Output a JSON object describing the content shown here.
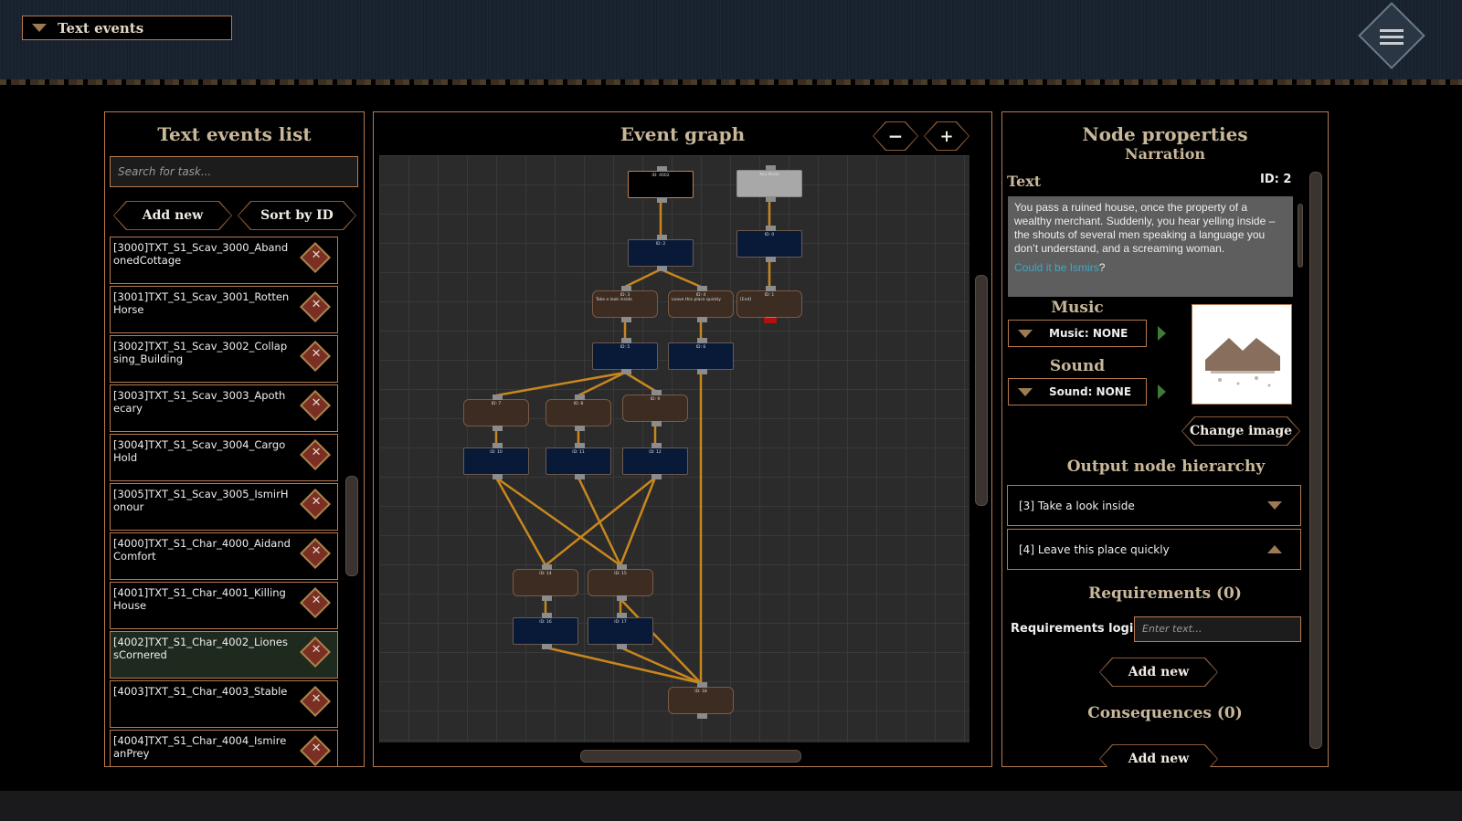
{
  "header": {
    "title": "Text events"
  },
  "list_panel": {
    "title": "Text events list",
    "search_placeholder": "Search for task...",
    "add_label": "Add new",
    "sort_label": "Sort by ID",
    "items": [
      {
        "label": "[3000]TXT_S1_Scav_3000_AbandonedCottage"
      },
      {
        "label": "[3001]TXT_S1_Scav_3001_RottenHorse"
      },
      {
        "label": "[3002]TXT_S1_Scav_3002_Collapsing_Building"
      },
      {
        "label": "[3003]TXT_S1_Scav_3003_Apothecary"
      },
      {
        "label": "[3004]TXT_S1_Scav_3004_CargoHold"
      },
      {
        "label": "[3005]TXT_S1_Scav_3005_IsmirHonour"
      },
      {
        "label": "[4000]TXT_S1_Char_4000_AidandComfort"
      },
      {
        "label": "[4001]TXT_S1_Char_4001_KillingHouse"
      },
      {
        "label": "[4002]TXT_S1_Char_4002_LionessCornered",
        "selected": true
      },
      {
        "label": "[4003]TXT_S1_Char_4003_Stable"
      },
      {
        "label": "[4004]TXT_S1_Char_4004_IsmireanPrey"
      }
    ]
  },
  "graph": {
    "title": "Event graph",
    "zoom_out": "−",
    "zoom_in": "+",
    "nodes": [
      {
        "id": "4002",
        "label": "ID: 4002",
        "type": "k"
      },
      {
        "id": "key",
        "label": "Key Node",
        "type": "g"
      },
      {
        "id": "2",
        "label": "ID: 2",
        "type": "b"
      },
      {
        "id": "0",
        "label": "ID: 0",
        "type": "b"
      },
      {
        "id": "3",
        "label": "ID: 3",
        "text": "Take a look inside",
        "type": "r"
      },
      {
        "id": "4",
        "label": "ID: 4",
        "text": "Leave this place quickly",
        "type": "r"
      },
      {
        "id": "1",
        "label": "ID: 1",
        "text": "[End]",
        "type": "r"
      },
      {
        "id": "5",
        "label": "ID: 5",
        "type": "b"
      },
      {
        "id": "6",
        "label": "ID: 6",
        "type": "b"
      },
      {
        "id": "7",
        "label": "ID: 7",
        "type": "r"
      },
      {
        "id": "8",
        "label": "ID: 8",
        "type": "r"
      },
      {
        "id": "9",
        "label": "ID: 9",
        "type": "r"
      },
      {
        "id": "10",
        "label": "ID: 10",
        "type": "b"
      },
      {
        "id": "11",
        "label": "ID: 11",
        "type": "b"
      },
      {
        "id": "12",
        "label": "ID: 12",
        "type": "b"
      },
      {
        "id": "14",
        "label": "ID: 14",
        "type": "r"
      },
      {
        "id": "15",
        "label": "ID: 15",
        "type": "r"
      },
      {
        "id": "16",
        "label": "ID: 16",
        "type": "b"
      },
      {
        "id": "17",
        "label": "ID: 17",
        "type": "b"
      },
      {
        "id": "18",
        "label": "ID: 18",
        "type": "r"
      }
    ],
    "edges": [
      [
        "4002",
        "2"
      ],
      [
        "key",
        "0"
      ],
      [
        "0",
        "1"
      ],
      [
        "2",
        "3"
      ],
      [
        "2",
        "4"
      ],
      [
        "3",
        "5"
      ],
      [
        "4",
        "6"
      ],
      [
        "5",
        "7"
      ],
      [
        "5",
        "8"
      ],
      [
        "5",
        "9"
      ],
      [
        "6",
        "18"
      ],
      [
        "7",
        "10"
      ],
      [
        "8",
        "11"
      ],
      [
        "9",
        "12"
      ],
      [
        "10",
        "14"
      ],
      [
        "10",
        "15"
      ],
      [
        "11",
        "15"
      ],
      [
        "12",
        "14"
      ],
      [
        "12",
        "15"
      ],
      [
        "14",
        "16"
      ],
      [
        "15",
        "17"
      ],
      [
        "16",
        "18"
      ],
      [
        "17",
        "18"
      ],
      [
        "15",
        "18"
      ]
    ],
    "edge_color": "#c8861e"
  },
  "props": {
    "title": "Node properties",
    "subtitle": "Narration",
    "text_label": "Text",
    "id_label": "ID: 2",
    "text": "You pass a ruined house, once the property of a wealthy merchant. Suddenly, you hear yelling inside – the shouts of several men speaking a language you don’t understand, and a screaming woman.",
    "text_link": "Could it be Ismirs",
    "text_after": "?",
    "music_label": "Music",
    "music_value": "Music: NONE",
    "sound_label": "Sound",
    "sound_value": "Sound: NONE",
    "change_image": "Change image",
    "output_title": "Output node hierarchy",
    "outputs": [
      {
        "label": "[3] Take a look inside"
      },
      {
        "label": "[4] Leave this place quickly"
      }
    ],
    "requirements_title": "Requirements (0)",
    "requirements_logic_label": "Requirements logic",
    "requirements_placeholder": "Enter text...",
    "add_new": "Add new",
    "consequences_title": "Consequences (0)"
  }
}
